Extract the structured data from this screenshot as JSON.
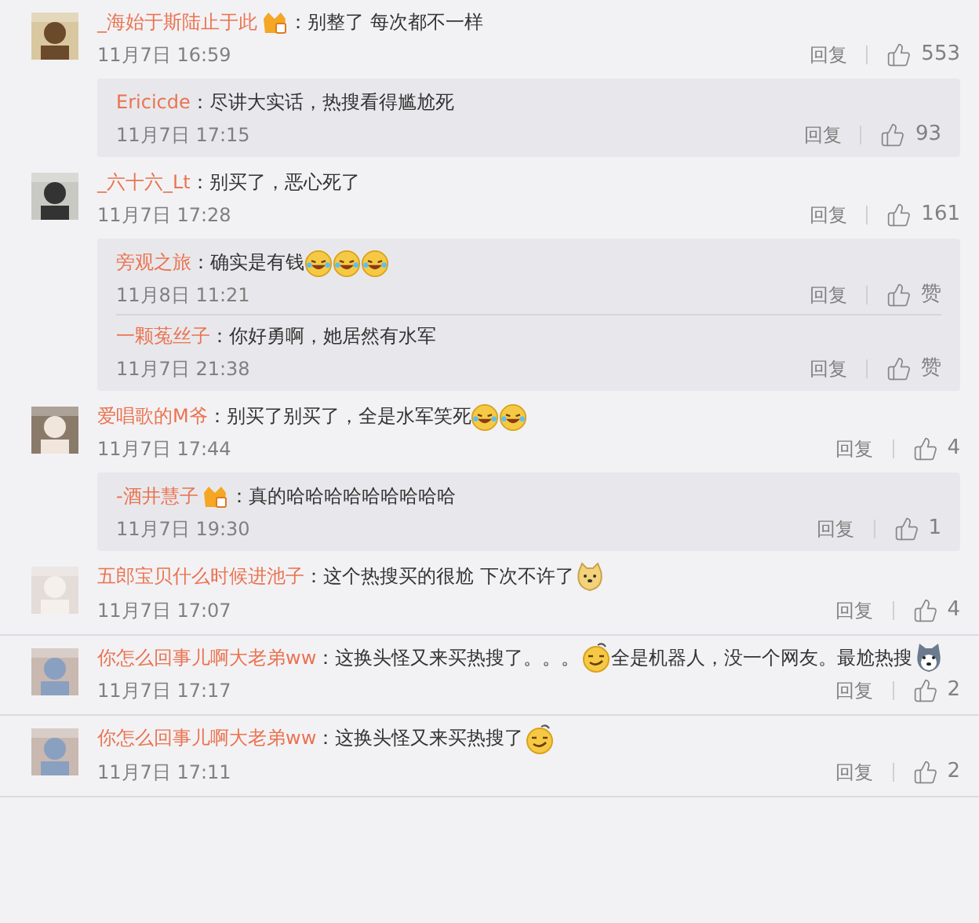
{
  "comments": [
    {
      "name": "_海始于斯陆止于此",
      "badge": true,
      "content": [
        {
          "kind": "text",
          "text": "：别整了 每次都不一样"
        }
      ],
      "time": "11月7日 16:59",
      "reply_label": "回复",
      "likes": "553",
      "replies": [
        {
          "name": "Ericicde",
          "badge": false,
          "content": [
            {
              "kind": "text",
              "text": "：尽讲大实话，热搜看得尴尬死"
            }
          ],
          "time": "11月7日 17:15",
          "reply_label": "回复",
          "likes": "93"
        }
      ]
    },
    {
      "name": "_六十六_Lt",
      "badge": false,
      "content": [
        {
          "kind": "text",
          "text": "：别买了，恶心死了"
        }
      ],
      "time": "11月7日 17:28",
      "reply_label": "回复",
      "likes": "161",
      "replies": [
        {
          "name": "旁观之旅",
          "badge": false,
          "content": [
            {
              "kind": "text",
              "text": "：确实是有钱"
            },
            {
              "kind": "laugh"
            },
            {
              "kind": "laugh"
            },
            {
              "kind": "laugh"
            }
          ],
          "time": "11月8日 11:21",
          "reply_label": "回复",
          "likes": "赞"
        },
        {
          "name": "一颗菟丝子",
          "badge": false,
          "content": [
            {
              "kind": "text",
              "text": "：你好勇啊，她居然有水军"
            }
          ],
          "time": "11月7日 21:38",
          "reply_label": "回复",
          "likes": "赞"
        }
      ]
    },
    {
      "name": "爱唱歌的M爷",
      "badge": false,
      "content": [
        {
          "kind": "text",
          "text": "：别买了别买了，全是水军笑死"
        },
        {
          "kind": "laugh"
        },
        {
          "kind": "laugh"
        }
      ],
      "time": "11月7日 17:44",
      "reply_label": "回复",
      "likes": "4",
      "replies": [
        {
          "name": "-酒井慧子",
          "badge": true,
          "content": [
            {
              "kind": "text",
              "text": "：真的哈哈哈哈哈哈哈哈哈"
            }
          ],
          "time": "11月7日 19:30",
          "reply_label": "回复",
          "likes": "1"
        }
      ]
    },
    {
      "name": "五郎宝贝什么时候进池子",
      "badge": false,
      "content": [
        {
          "kind": "text",
          "text": "：这个热搜买的很尬 下次不许了"
        },
        {
          "kind": "doge"
        }
      ],
      "time": "11月7日 17:07",
      "reply_label": "回复",
      "likes": "4"
    },
    {
      "name": "你怎么回事儿啊大老弟ww",
      "badge": false,
      "content": [
        {
          "kind": "text",
          "text": "：这换头怪又来买热搜了。。。"
        },
        {
          "kind": "smug"
        },
        {
          "kind": "text",
          "text": "全是机器人，没一个网友。最尬热搜"
        },
        {
          "kind": "husky"
        }
      ],
      "time": "11月7日 17:17",
      "reply_label": "回复",
      "likes": "2"
    },
    {
      "name": "你怎么回事儿啊大老弟ww",
      "badge": false,
      "content": [
        {
          "kind": "text",
          "text": "：这换头怪又来买热搜了"
        },
        {
          "kind": "smug"
        }
      ],
      "time": "11月7日 17:11",
      "reply_label": "回复",
      "likes": "2"
    }
  ]
}
